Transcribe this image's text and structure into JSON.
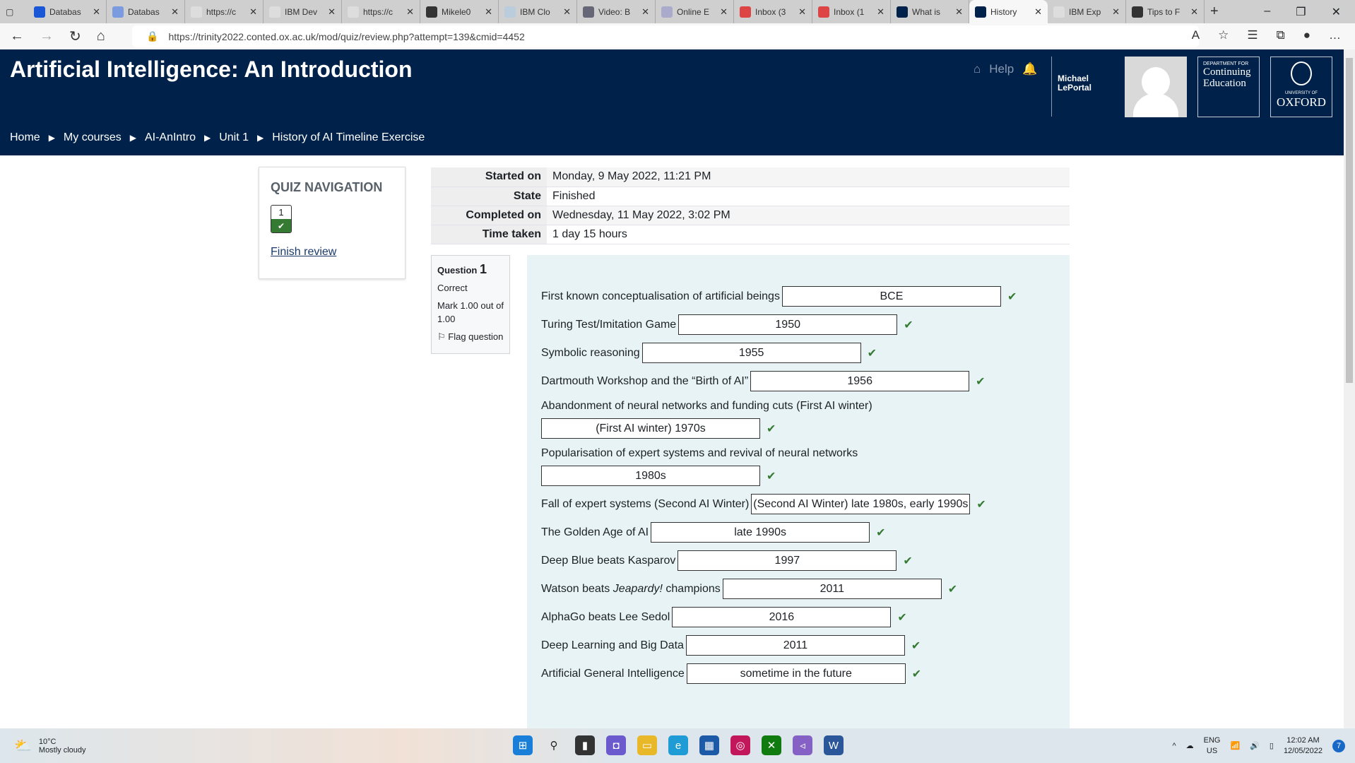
{
  "browser": {
    "tabs": [
      {
        "label": "Databas",
        "icon": "chrome-c-icon",
        "color": "#1a57d6"
      },
      {
        "label": "Databas",
        "icon": "chrome-c-icon",
        "color": "#7a9be0"
      },
      {
        "label": "https://c",
        "icon": "page-icon",
        "color": "#ddd"
      },
      {
        "label": "IBM Dev",
        "icon": "page-icon",
        "color": "#ddd"
      },
      {
        "label": "https://c",
        "icon": "page-icon",
        "color": "#ddd"
      },
      {
        "label": "Mikele0",
        "icon": "github-icon",
        "color": "#333"
      },
      {
        "label": "IBM Clo",
        "icon": "cloud-icon",
        "color": "#bcd"
      },
      {
        "label": "Video: B",
        "icon": "video-icon",
        "color": "#667"
      },
      {
        "label": "Online E",
        "icon": "bookmark-icon",
        "color": "#aac"
      },
      {
        "label": "Inbox (3",
        "icon": "gmail-icon",
        "color": "#d44"
      },
      {
        "label": "Inbox (1",
        "icon": "gmail-icon",
        "color": "#d44"
      },
      {
        "label": "What is",
        "icon": "moodle-icon",
        "color": "#00224a"
      },
      {
        "label": "History",
        "icon": "moodle-icon",
        "color": "#00224a",
        "active": true
      },
      {
        "label": "IBM Exp",
        "icon": "page-icon",
        "color": "#ddd"
      },
      {
        "label": "Tips to F",
        "icon": "bee-icon",
        "color": "#333"
      }
    ],
    "url": "https://trinity2022.conted.ox.ac.uk/mod/quiz/review.php?attempt=139&cmid=4452"
  },
  "header": {
    "title": "Artificial Intelligence: An Introduction",
    "help": "Help",
    "user": [
      "Michael",
      "LePortal"
    ],
    "dce": {
      "small": "DEPARTMENT FOR",
      "line1": "Continuing",
      "line2": "Education"
    },
    "oxford": {
      "small": "UNIVERSITY OF",
      "name": "OXFORD"
    },
    "breadcrumb": [
      "Home",
      "My courses",
      "AI-AnIntro",
      "Unit 1",
      "History of AI Timeline Exercise"
    ]
  },
  "quiz_nav": {
    "title": "QUIZ NAVIGATION",
    "question_number": "1",
    "status": "correct",
    "finish": "Finish review"
  },
  "summary": [
    {
      "label": "Started on",
      "value": "Monday, 9 May 2022, 11:21 PM"
    },
    {
      "label": "State",
      "value": "Finished"
    },
    {
      "label": "Completed on",
      "value": "Wednesday, 11 May 2022, 3:02 PM"
    },
    {
      "label": "Time taken",
      "value": "1 day 15 hours"
    }
  ],
  "question_info": {
    "prefix": "Question",
    "number": "1",
    "state": "Correct",
    "mark": "Mark 1.00 out of 1.00",
    "flag": "Flag question"
  },
  "items": [
    {
      "label": "First known conceptualisation of artificial beings",
      "answer": "BCE",
      "wrap": false
    },
    {
      "label": "Turing Test/Imitation Game",
      "answer": "1950",
      "wrap": false
    },
    {
      "label": "Symbolic reasoning",
      "answer": "1955",
      "wrap": false
    },
    {
      "label": "Dartmouth Workshop and the “Birth of AI”",
      "answer": "1956",
      "wrap": false
    },
    {
      "label": "Abandonment of neural networks and funding cuts (First AI winter)",
      "answer": "(First AI winter) 1970s",
      "wrap": true
    },
    {
      "label": "Popularisation of expert systems and revival of neural networks",
      "answer": "1980s",
      "wrap": true
    },
    {
      "label": "Fall of expert systems (Second AI Winter)",
      "answer": "(Second AI Winter) late 1980s, early 1990s",
      "wrap": false
    },
    {
      "label": "The Golden Age of AI",
      "answer": "late 1990s",
      "wrap": false
    },
    {
      "label": "Deep Blue beats Kasparov",
      "answer": "1997",
      "wrap": false
    },
    {
      "label": "Watson beats Jeapardy! champions",
      "answer": "2011",
      "wrap": false
    },
    {
      "label": "AlphaGo beats Lee Sedol",
      "answer": "2016",
      "wrap": false
    },
    {
      "label": "Deep Learning and Big Data",
      "answer": "2011",
      "wrap": false
    },
    {
      "label": "Artificial General Intelligence",
      "answer": "sometime in the future",
      "wrap": false
    }
  ],
  "taskbar": {
    "temp": "10°C",
    "weather": "Mostly cloudy",
    "lang1": "ENG",
    "lang2": "US",
    "time": "12:02 AM",
    "date": "12/05/2022",
    "notifications": "7"
  }
}
